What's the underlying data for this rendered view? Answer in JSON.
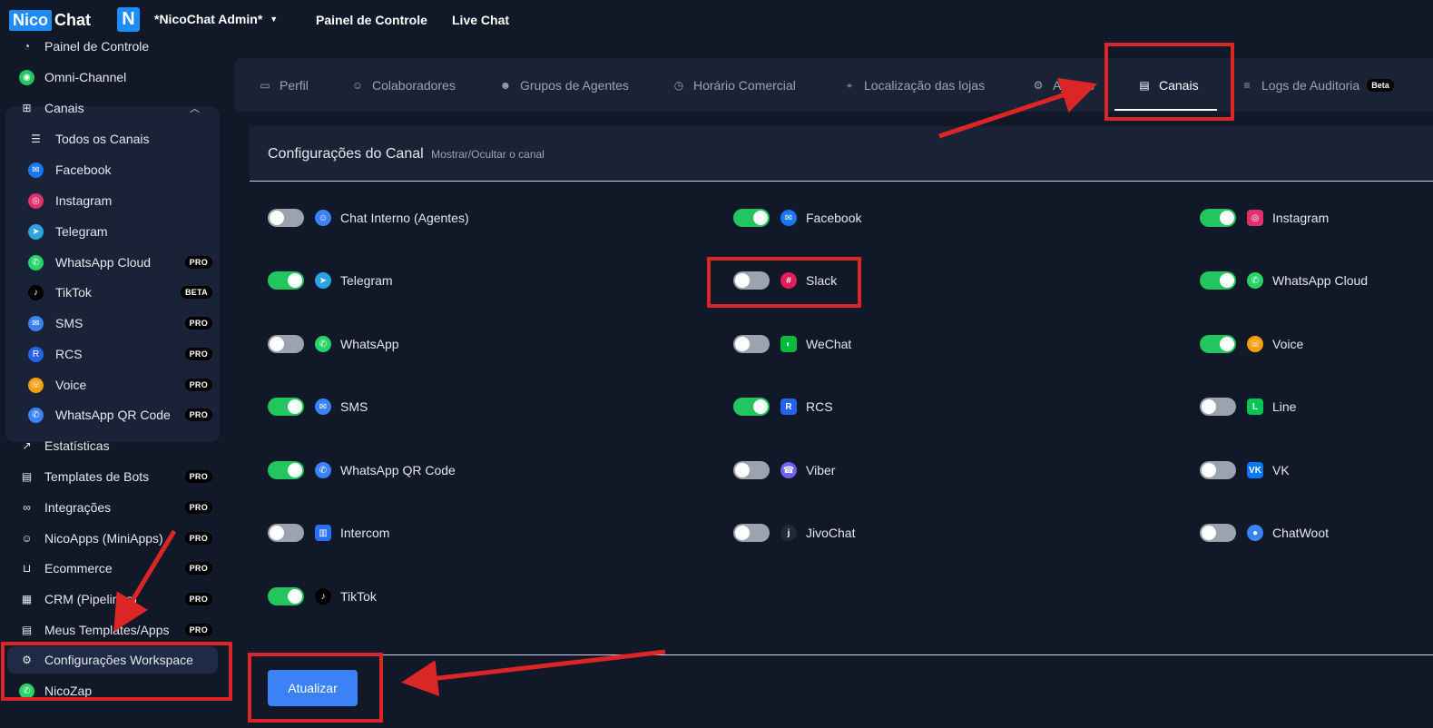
{
  "topbar": {
    "logo_nico": "Nico",
    "logo_chat": "Chat",
    "workspace_initial": "N",
    "workspace_name": "*NicoChat Admin*",
    "nav": [
      "Painel de Controle",
      "Live Chat"
    ]
  },
  "sidebar": {
    "items": [
      {
        "label": "Painel de Controle",
        "icon": "dashboard-icon"
      },
      {
        "label": "Omni-Channel",
        "icon": "omni-channel-icon"
      },
      {
        "label": "Canais",
        "icon": "sitemap-icon"
      },
      {
        "label": "Todos os Canais",
        "icon": "list-icon"
      },
      {
        "label": "Facebook",
        "icon": "messenger-icon"
      },
      {
        "label": "Instagram",
        "icon": "instagram-icon"
      },
      {
        "label": "Telegram",
        "icon": "telegram-icon"
      },
      {
        "label": "WhatsApp Cloud",
        "icon": "whatsapp-icon",
        "tag": "PRO"
      },
      {
        "label": "TikTok",
        "icon": "tiktok-icon",
        "tag": "BETA"
      },
      {
        "label": "SMS",
        "icon": "sms-icon",
        "tag": "PRO"
      },
      {
        "label": "RCS",
        "icon": "rcs-icon",
        "tag": "PRO"
      },
      {
        "label": "Voice",
        "icon": "voice-icon",
        "tag": "PRO"
      },
      {
        "label": "WhatsApp QR Code",
        "icon": "whatsapp-qr-icon",
        "tag": "PRO"
      },
      {
        "label": "Estatísticas",
        "icon": "chart-icon"
      },
      {
        "label": "Templates de Bots",
        "icon": "bookmark-icon",
        "tag": "PRO"
      },
      {
        "label": "Integrações",
        "icon": "link-icon",
        "tag": "PRO"
      },
      {
        "label": "NicoApps (MiniApps)",
        "icon": "user-pin-icon",
        "tag": "PRO"
      },
      {
        "label": "Ecommerce",
        "icon": "cart-icon",
        "tag": "PRO"
      },
      {
        "label": "CRM (Pipelines)",
        "icon": "crm-icon",
        "tag": "PRO"
      },
      {
        "label": "Meus Templates/Apps",
        "icon": "template-icon",
        "tag": "PRO"
      },
      {
        "label": "Configurações Workspace",
        "icon": "gear-icon"
      },
      {
        "label": "NicoZap",
        "icon": "whatsapp-icon"
      }
    ]
  },
  "tabs": [
    {
      "label": "Perfil",
      "icon": "briefcase-icon"
    },
    {
      "label": "Colaboradores",
      "icon": "user-icon"
    },
    {
      "label": "Grupos de Agentes",
      "icon": "users-icon"
    },
    {
      "label": "Horário Comercial",
      "icon": "clock-icon"
    },
    {
      "label": "Localização das lojas",
      "icon": "location-icon"
    },
    {
      "label": "Ajustes",
      "icon": "gear-icon"
    },
    {
      "label": "Canais",
      "icon": "document-icon",
      "active": true
    },
    {
      "label": "Logs de Auditoria",
      "icon": "database-icon",
      "badge": "Beta"
    }
  ],
  "panel": {
    "title": "Configurações do Canal",
    "subtitle": "Mostrar/Ocultar o canal",
    "update_label": "Atualizar"
  },
  "channels": [
    {
      "label": "Chat Interno (Agentes)",
      "on": false,
      "icon": "agent-icon",
      "color": "#3b82f6"
    },
    {
      "label": "Facebook",
      "on": true,
      "icon": "messenger-icon",
      "color": "#1877f2"
    },
    {
      "label": "Instagram",
      "on": true,
      "icon": "instagram-icon",
      "color": "#e1306c"
    },
    {
      "label": "Telegram",
      "on": true,
      "icon": "telegram-icon",
      "color": "#2aa3de"
    },
    {
      "label": "Slack",
      "on": false,
      "icon": "slack-icon",
      "color": "#e01e5a"
    },
    {
      "label": "WhatsApp Cloud",
      "on": true,
      "icon": "whatsapp-icon",
      "color": "#25d366"
    },
    {
      "label": "WhatsApp",
      "on": false,
      "icon": "whatsapp-icon",
      "color": "#25d366"
    },
    {
      "label": "WeChat",
      "on": false,
      "icon": "wechat-icon",
      "color": "#09b83e"
    },
    {
      "label": "Voice",
      "on": true,
      "icon": "voice-icon",
      "color": "#f59e0b"
    },
    {
      "label": "SMS",
      "on": true,
      "icon": "sms-icon",
      "color": "#3b82f6"
    },
    {
      "label": "RCS",
      "on": true,
      "icon": "rcs-icon",
      "color": "#2563eb"
    },
    {
      "label": "Line",
      "on": false,
      "icon": "line-icon",
      "color": "#06c755"
    },
    {
      "label": "WhatsApp QR Code",
      "on": true,
      "icon": "whatsapp-qr-icon",
      "color": "#3b82f6"
    },
    {
      "label": "Viber",
      "on": false,
      "icon": "viber-icon",
      "color": "#7360f2"
    },
    {
      "label": "VK",
      "on": false,
      "icon": "vk-icon",
      "color": "#0077ff"
    },
    {
      "label": "Intercom",
      "on": false,
      "icon": "intercom-icon",
      "color": "#286efa"
    },
    {
      "label": "JivoChat",
      "on": false,
      "icon": "jivochat-icon",
      "color": "#1f2937"
    },
    {
      "label": "ChatWoot",
      "on": false,
      "icon": "chatwoot-icon",
      "color": "#3b82f6"
    },
    {
      "label": "TikTok",
      "on": true,
      "icon": "tiktok-icon",
      "color": "#000000"
    }
  ],
  "colors": {
    "accent": "#3b82f6",
    "toggle_on": "#22c55e",
    "toggle_off": "#9ca3af",
    "annotation": "#dc2626"
  }
}
